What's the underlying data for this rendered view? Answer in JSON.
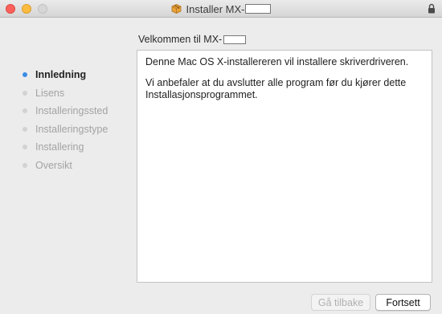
{
  "window": {
    "title_prefix": "Installer MX-",
    "welcome_prefix": "Velkommen til MX-"
  },
  "sidebar": {
    "steps": [
      {
        "label": "Innledning",
        "active": true
      },
      {
        "label": "Lisens",
        "active": false
      },
      {
        "label": "Installeringssted",
        "active": false
      },
      {
        "label": "Installeringstype",
        "active": false
      },
      {
        "label": "Installering",
        "active": false
      },
      {
        "label": "Oversikt",
        "active": false
      }
    ]
  },
  "content": {
    "paragraph1": "Denne Mac OS X-installereren vil installere skriverdriveren.",
    "paragraph2": "Vi anbefaler at du avslutter alle program før du kjører dette Installasjonsprogrammet."
  },
  "buttons": {
    "back_label": "Gå tilbake",
    "continue_label": "Fortsett"
  },
  "colors": {
    "active_step_dot": "#3b8be6",
    "accent": "#1ba0e2"
  }
}
